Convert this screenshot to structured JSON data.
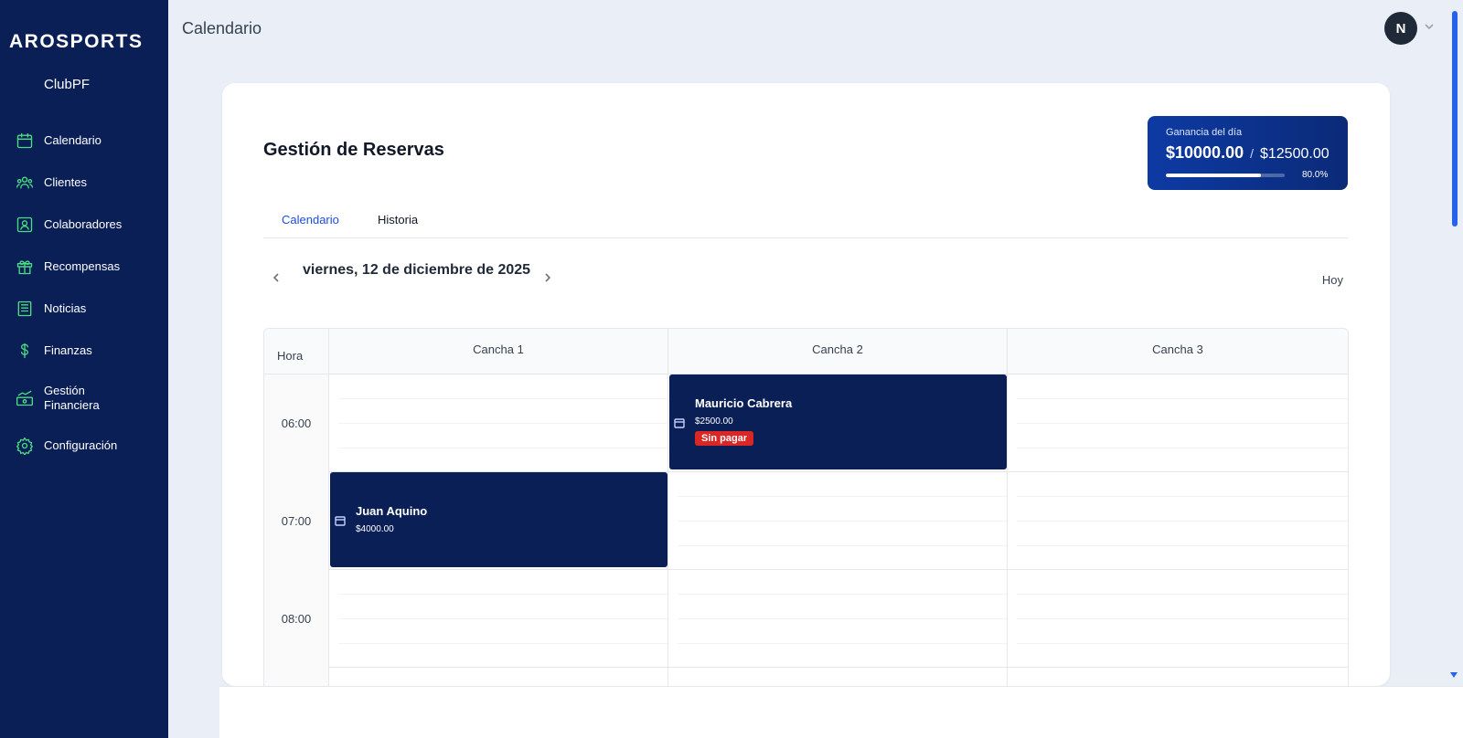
{
  "sidebar": {
    "brand": "AROSPORTS",
    "club": "ClubPF",
    "items": [
      {
        "label": "Calendario",
        "icon": "calendar-icon"
      },
      {
        "label": "Clientes",
        "icon": "users-icon"
      },
      {
        "label": "Colaboradores",
        "icon": "id-card-icon"
      },
      {
        "label": "Recompensas",
        "icon": "gift-icon"
      },
      {
        "label": "Noticias",
        "icon": "newspaper-icon"
      },
      {
        "label": "Finanzas",
        "icon": "dollar-icon"
      },
      {
        "label": "Gestión\nFinanciera",
        "icon": "money-chart-icon"
      },
      {
        "label": "Configuración",
        "icon": "gear-icon"
      }
    ]
  },
  "topbar": {
    "title": "Calendario",
    "avatar_initial": "N"
  },
  "main": {
    "title": "Gestión de Reservas",
    "earnings": {
      "label": "Ganancia del día",
      "current": "$10000.00",
      "separator": "/",
      "total": "$12500.00",
      "percent_text": "80.0%",
      "progress": 0.8
    },
    "tabs": [
      {
        "label": "Calendario",
        "active": true
      },
      {
        "label": "Historia",
        "active": false
      }
    ],
    "date": "viernes, 12 de diciembre de 2025",
    "today_label": "Hoy",
    "grid": {
      "hour_header": "Hora",
      "courts": [
        "Cancha 1",
        "Cancha 2",
        "Cancha 3"
      ],
      "hours": [
        "06:00",
        "07:00",
        "08:00"
      ]
    },
    "bookings": [
      {
        "name": "Mauricio Cabrera",
        "price": "$2500.00",
        "badge": "Sin pagar",
        "court": "Cancha 2",
        "hour": "06:00"
      },
      {
        "name": "Juan Aquino",
        "price": "$4000.00",
        "court": "Cancha 1",
        "hour": "07:00"
      }
    ]
  },
  "colors": {
    "sidebar_bg": "#0b1f57",
    "accent_green": "#4ade80",
    "booking_bg": "#0b1f57",
    "badge_red": "#dc2626",
    "active_tab": "#1d4ed8"
  }
}
